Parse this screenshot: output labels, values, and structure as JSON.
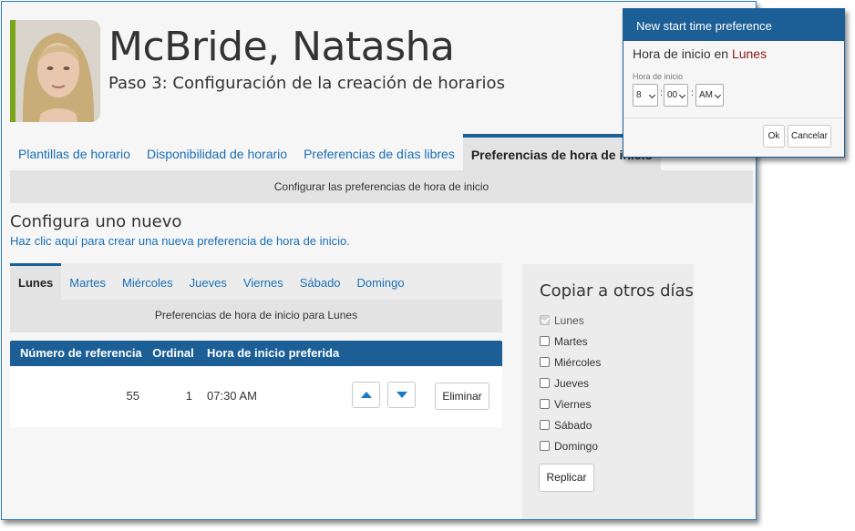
{
  "header": {
    "person_name": "McBride, Natasha",
    "step_title": "Paso 3: Configuración de la creación de horarios"
  },
  "main_tabs": [
    {
      "label": "Plantillas de horario",
      "active": false
    },
    {
      "label": "Disponibilidad de horario",
      "active": false
    },
    {
      "label": "Preferencias de días libres",
      "active": false
    },
    {
      "label": "Preferencias de hora de inicio",
      "active": true
    }
  ],
  "subbar_text": "Configurar las preferencias de hora de inicio",
  "configure": {
    "title": "Configura uno nuevo",
    "link": "Haz clic aquí para crear una nueva preferencia de hora de inicio."
  },
  "day_tabs": [
    {
      "label": "Lunes",
      "active": true
    },
    {
      "label": "Martes",
      "active": false
    },
    {
      "label": "Miércoles",
      "active": false
    },
    {
      "label": "Jueves",
      "active": false
    },
    {
      "label": "Viernes",
      "active": false
    },
    {
      "label": "Sábado",
      "active": false
    },
    {
      "label": "Domingo",
      "active": false
    }
  ],
  "day_subbar_text": "Preferencias de hora de inicio para Lunes",
  "table": {
    "headers": [
      "Número de referencia",
      "Ordinal",
      "Hora de inicio preferida"
    ],
    "rows": [
      {
        "reference": "55",
        "ordinal": "1",
        "time": "07:30 AM",
        "delete_label": "Eliminar"
      }
    ]
  },
  "copy_panel": {
    "title": "Copiar a otros días",
    "days": [
      {
        "label": "Lunes",
        "checked": true,
        "disabled": true
      },
      {
        "label": "Martes",
        "checked": false,
        "disabled": false
      },
      {
        "label": "Miércoles",
        "checked": false,
        "disabled": false
      },
      {
        "label": "Jueves",
        "checked": false,
        "disabled": false
      },
      {
        "label": "Viernes",
        "checked": false,
        "disabled": false
      },
      {
        "label": "Sábado",
        "checked": false,
        "disabled": false
      },
      {
        "label": "Domingo",
        "checked": false,
        "disabled": false
      }
    ],
    "replicate_label": "Replicar"
  },
  "dialog": {
    "title": "New start time preference",
    "heading_prefix": "Hora de inicio en",
    "heading_day": "Lunes",
    "field_label": "Hora de inicio",
    "hour": "8",
    "minute": "00",
    "ampm": "AM",
    "ok_label": "Ok",
    "cancel_label": "Cancelar"
  },
  "colors": {
    "accent": "#1b5f96",
    "link": "#1a6fb5",
    "photo_bar": "#7aa51c",
    "day_highlight": "#8a1a1a"
  }
}
